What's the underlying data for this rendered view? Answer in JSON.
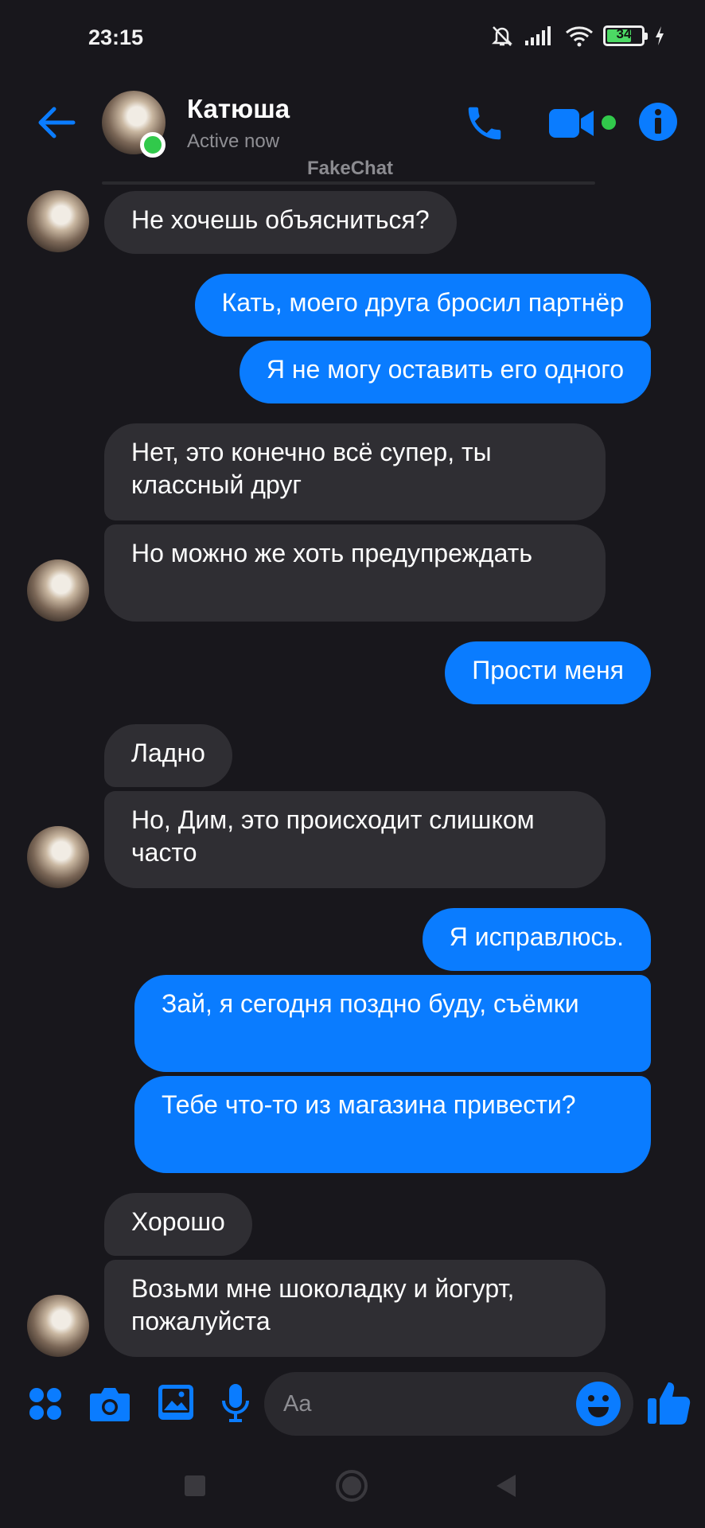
{
  "status_bar": {
    "time": "23:15",
    "battery": "34"
  },
  "header": {
    "name": "Катюша",
    "status": "Active now",
    "watermark": "FakeChat",
    "accent": "#0a7cff"
  },
  "messages": [
    {
      "dir": "in",
      "text": "Не хочешь объясниться?"
    },
    {
      "dir": "out",
      "text": "Кать, моего друга бросил партнёр"
    },
    {
      "dir": "out",
      "text": "Я не могу оставить его одного"
    },
    {
      "dir": "in",
      "text": "Нет, это конечно всё супер, ты классный друг"
    },
    {
      "dir": "in",
      "text": "Но можно же хоть предупреждать"
    },
    {
      "dir": "out",
      "text": "Прости меня"
    },
    {
      "dir": "in",
      "text": "Ладно"
    },
    {
      "dir": "in",
      "text": "Но, Дим, это происходит слишком часто"
    },
    {
      "dir": "out",
      "text": "Я исправлюсь."
    },
    {
      "dir": "out",
      "text": "Зай, я сегодня поздно буду, съёмки"
    },
    {
      "dir": "out",
      "text": "Тебе что-то из магазина привести?"
    },
    {
      "dir": "in",
      "text": "Хорошо"
    },
    {
      "dir": "in",
      "text": "Возьми мне шоколадку и йогурт, пожалуйста"
    }
  ],
  "composer": {
    "placeholder": "Aa"
  },
  "icons": {
    "back": "arrow-left-icon",
    "call": "phone-icon",
    "video": "video-camera-icon",
    "info": "info-icon",
    "apps": "apps-icon",
    "camera": "camera-icon",
    "gallery": "image-icon",
    "mic": "microphone-icon",
    "emoji": "emoji-icon",
    "like": "thumbs-up-icon"
  }
}
